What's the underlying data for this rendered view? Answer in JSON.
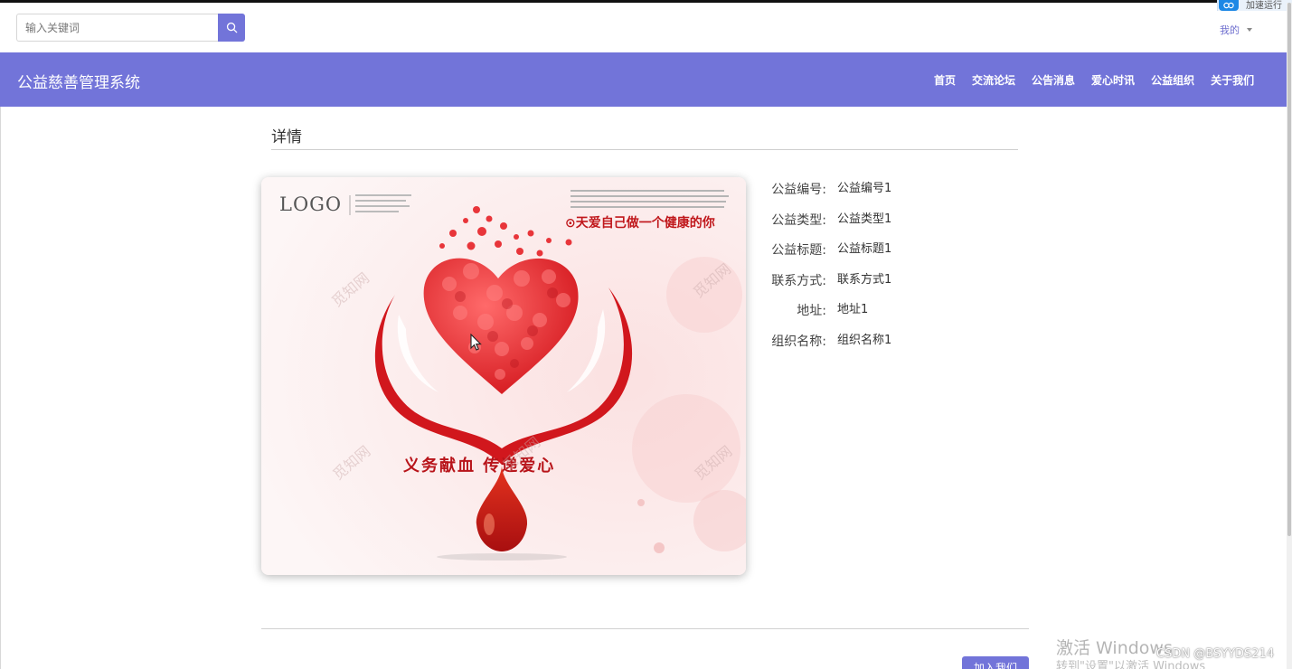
{
  "search": {
    "placeholder": "输入关键词",
    "icon": "search-icon"
  },
  "user_menu": {
    "label": "我的",
    "icon": "caret-down-icon"
  },
  "corner_badge": {
    "text": "加速运行"
  },
  "navbar": {
    "brand": "公益慈善管理系统",
    "items": [
      {
        "label": "首页"
      },
      {
        "label": "交流论坛"
      },
      {
        "label": "公告消息"
      },
      {
        "label": "爱心时讯"
      },
      {
        "label": "公益组织"
      },
      {
        "label": "关于我们"
      }
    ]
  },
  "detail": {
    "title": "详情",
    "poster": {
      "logo_text": "LOGO",
      "slogan": "⊙天爱自己做一个健康的你",
      "headline": "义务献血  传递爱心",
      "watermark": "觅知网"
    },
    "fields": [
      {
        "label": "公益编号:",
        "value": "公益编号1"
      },
      {
        "label": "公益类型:",
        "value": "公益类型1"
      },
      {
        "label": "公益标题:",
        "value": "公益标题1"
      },
      {
        "label": "联系方式:",
        "value": "联系方式1"
      },
      {
        "label": "地址:",
        "value": "地址1"
      },
      {
        "label": "组织名称:",
        "value": "组织名称1"
      }
    ],
    "join_button": "加入我们"
  },
  "overlay": {
    "activate_title": "激活 Windows",
    "activate_sub": "转到\"设置\"以激活 Windows",
    "csdn": "CSDN @BSYYDS214"
  },
  "colors": {
    "accent": "#7274d9",
    "poster_red": "#d4181e"
  }
}
